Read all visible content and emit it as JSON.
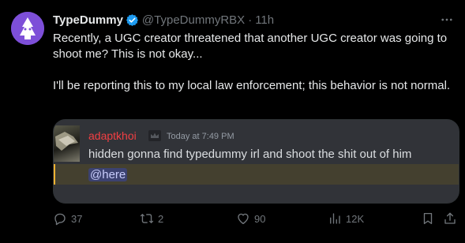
{
  "header": {
    "display_name": "TypeDummy",
    "handle": "@TypeDummyRBX",
    "separator": "·",
    "time": "11h"
  },
  "body": {
    "paragraph1": "Recently, a UGC creator threatened that another UGC creator was going to shoot me? This is not okay...",
    "paragraph2": "I'll be reporting this to my local law enforcement; this behavior is not normal."
  },
  "embed": {
    "username": "adaptkhoi",
    "timestamp": "Today at 7:49 PM",
    "message": "hidden gonna find typedummy irl and shoot the shit out of him",
    "mention": "@here",
    "username_color": "#f23f43"
  },
  "actions": {
    "replies": "37",
    "reposts": "2",
    "likes": "90",
    "views": "12K"
  },
  "icons": {
    "avatar": "profile-avatar",
    "verified": "verified-badge-icon",
    "more": "more-icon",
    "reply": "reply-icon",
    "repost": "repost-icon",
    "like": "heart-icon",
    "views": "views-icon",
    "bookmark": "bookmark-icon",
    "share": "share-icon"
  },
  "colors": {
    "background": "#000000",
    "text": "#e7e9ea",
    "secondary": "#71767b",
    "verified": "#1d9bf0",
    "avatar_bg": "#7d4fd8"
  }
}
